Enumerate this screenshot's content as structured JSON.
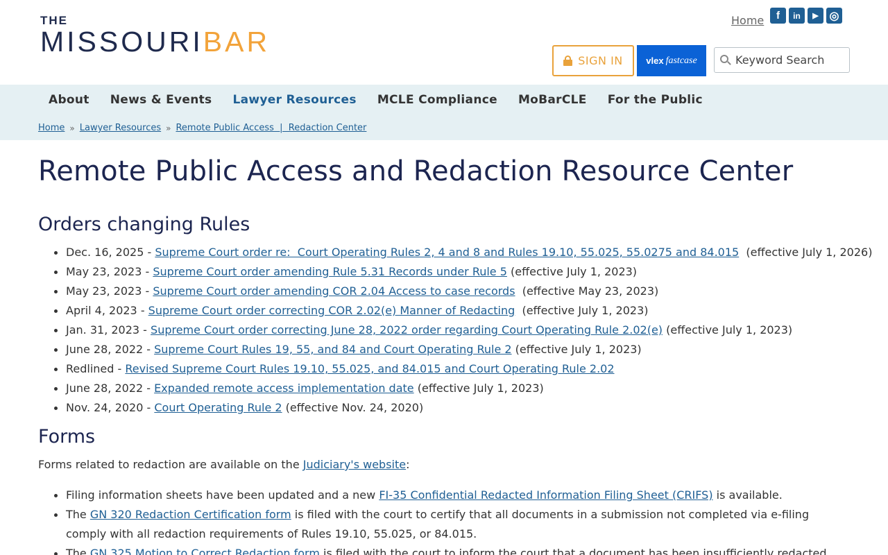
{
  "header": {
    "logo_the": "THE",
    "logo_missouri": "MISSOURI",
    "logo_bar": "BAR",
    "home_link": "Home",
    "socials": [
      {
        "icon": "facebook-icon",
        "glyph": "f"
      },
      {
        "icon": "linkedin-icon",
        "glyph": "in"
      },
      {
        "icon": "youtube-icon",
        "glyph": "▶"
      },
      {
        "icon": "instagram-icon",
        "glyph": "◎"
      }
    ],
    "signin_label": "SIGN IN",
    "fastcase_vlex": "vlex",
    "fastcase_name": "fastcase",
    "search_placeholder": "Keyword Search",
    "accent_color": "#e9a23b",
    "brand_color": "#1c2550"
  },
  "nav": {
    "items": [
      "About",
      "News & Events",
      "Lawyer Resources",
      "MCLE Compliance",
      "MoBarCLE",
      "For the Public"
    ],
    "active": "Lawyer Resources"
  },
  "breadcrumb": {
    "items": [
      "Home",
      "Lawyer Resources",
      "Remote Public Access  |  Redaction Center"
    ],
    "separator": "»"
  },
  "main": {
    "title": "Remote Public Access and Redaction Resource Center",
    "orders_heading": "Orders changing Rules",
    "orders": [
      {
        "date": "Dec. 16, 2025 - ",
        "link": "Supreme Court order re:  Court Operating Rules 2, 4 and 8 and Rules 19.10, 55.025, 55.0275 and 84.015",
        "suffix": "  (effective July 1, 2026)"
      },
      {
        "date": "May 23, 2023 - ",
        "link": "Supreme Court order amending Rule 5.31 Records under Rule 5",
        "suffix": " (effective July 1, 2023)"
      },
      {
        "date": "May 23, 2023 - ",
        "link": "Supreme Court order amending COR 2.04 Access to case records",
        "suffix": "  (effective May 23, 2023)"
      },
      {
        "date": "April 4, 2023 - ",
        "link": "Supreme Court order correcting COR 2.02(e) Manner of Redacting",
        "suffix": "  (effective July 1, 2023)"
      },
      {
        "date": "Jan. 31, 2023 - ",
        "link": "Supreme Court order correcting June 28, 2022 order regarding Court Operating Rule 2.02(e)",
        "suffix": " (effective July 1, 2023)"
      },
      {
        "date": "June 28, 2022 - ",
        "link": "Supreme Court Rules 19, 55, and 84 and Court Operating Rule 2",
        "suffix": " (effective July 1, 2023)"
      },
      {
        "date": "Redlined - ",
        "link": "Revised Supreme Court Rules 19.10, 55.025, and 84.015 and Court Operating Rule 2.02",
        "suffix": ""
      },
      {
        "date": "June 28, 2022 - ",
        "link": "Expanded remote access implementation date",
        "suffix": " (effective July 1, 2023)"
      },
      {
        "date": "Nov. 24, 2020 - ",
        "link": "Court Operating Rule 2",
        "suffix": " (effective Nov. 24, 2020)"
      }
    ],
    "forms_heading": "Forms",
    "forms_intro_pre": "Forms related to redaction are available on the ",
    "forms_intro_link": "Judiciary's website",
    "forms_intro_post": ":",
    "forms": [
      {
        "pre": "Filing information sheets have been updated and a new ",
        "link": "FI-35 Confidential Redacted Information Filing Sheet (CRIFS)",
        "post": " is available."
      },
      {
        "pre": "The ",
        "link": "GN 320 Redaction Certification form",
        "post": " is filed with the court to certify that all documents in a submission not completed via e-filing comply with all redaction requirements of Rules 19.10, 55.025, or 84.015."
      },
      {
        "pre": "The ",
        "link": "GN 325 Motion to Correct Redaction form",
        "post": " is filed with the court to inform the court that a document has been insufficiently redacted and to"
      }
    ]
  }
}
